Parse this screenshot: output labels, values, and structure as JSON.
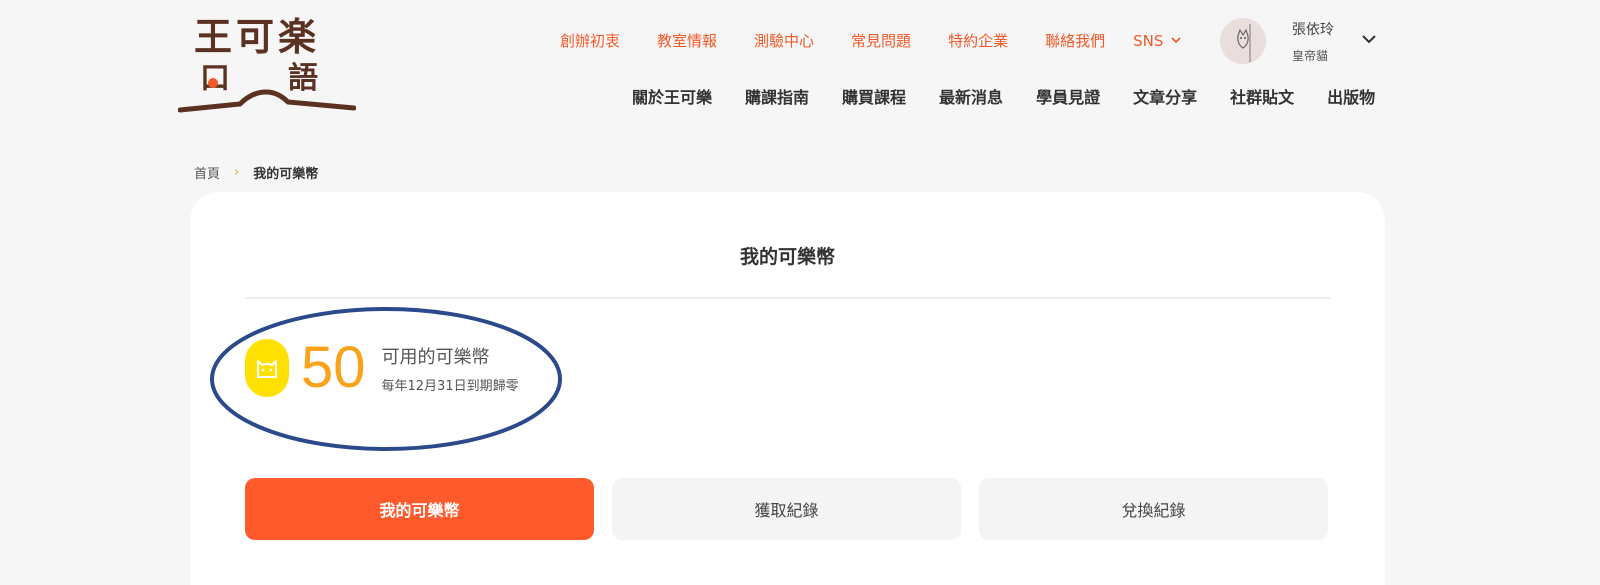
{
  "logo": {
    "row1": "王可楽",
    "row2_left": "口",
    "row2_right": "語"
  },
  "topnav": {
    "items": [
      "創辦初衷",
      "教室情報",
      "測驗中心",
      "常見問題",
      "特約企業",
      "聯絡我們"
    ],
    "sns_label": "SNS"
  },
  "user": {
    "name": "張依玲",
    "subtitle": "皇帝貓"
  },
  "mainnav": {
    "items": [
      "關於王可樂",
      "購課指南",
      "購買課程",
      "最新消息",
      "學員見證",
      "文章分享",
      "社群貼文",
      "出版物"
    ]
  },
  "breadcrumb": {
    "home": "首頁",
    "separator": "›",
    "current": "我的可樂幣"
  },
  "page_title": "我的可樂幣",
  "coins": {
    "value": "50",
    "label": "可用的可樂幣",
    "note": "每年12月31日到期歸零"
  },
  "tabs": [
    {
      "label": "我的可樂幣",
      "active": true
    },
    {
      "label": "獲取紀錄",
      "active": false
    },
    {
      "label": "兌換紀錄",
      "active": false
    }
  ],
  "colors": {
    "accent": "#f05a28",
    "active_tab": "#ff5a2c",
    "coin_yellow": "#ffe000",
    "coin_value": "#f9a21a",
    "annotation_ellipse": "#2b4a8b",
    "logo_brown": "#5b3222"
  }
}
